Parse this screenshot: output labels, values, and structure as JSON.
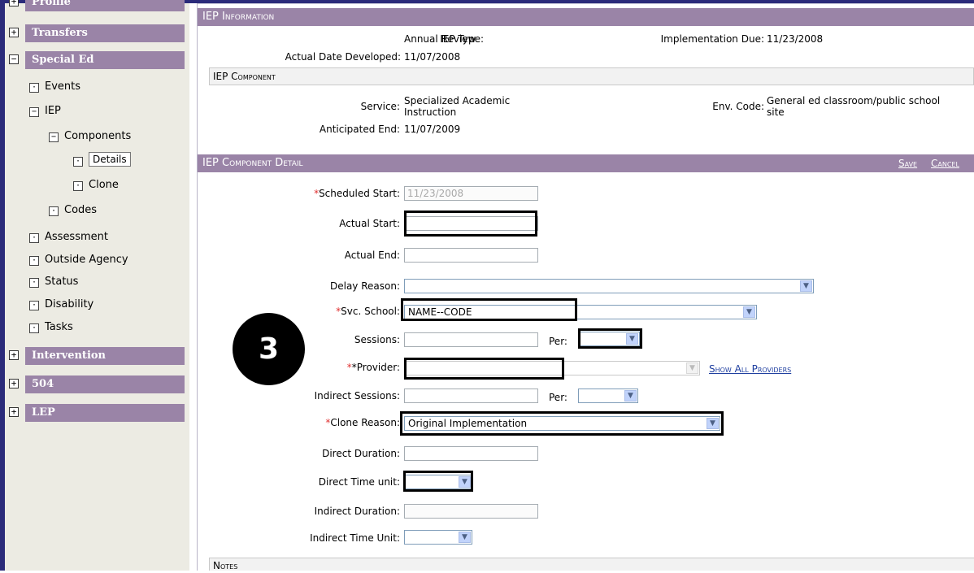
{
  "sidebar": {
    "sections": [
      {
        "label": "Profile",
        "toggle": "+"
      },
      {
        "label": "Transfers",
        "toggle": "+"
      },
      {
        "label": "Special Ed",
        "toggle": "−"
      },
      {
        "label": "Intervention",
        "toggle": "+"
      },
      {
        "label": "504",
        "toggle": "+"
      },
      {
        "label": "LEP",
        "toggle": "+"
      }
    ],
    "tree": [
      {
        "label": "Events",
        "toggle": "·"
      },
      {
        "label": "IEP",
        "toggle": "−"
      },
      {
        "label": "Components",
        "toggle": "−"
      },
      {
        "label": "Details",
        "toggle": "·"
      },
      {
        "label": "Clone",
        "toggle": "·"
      },
      {
        "label": "Codes",
        "toggle": "·"
      },
      {
        "label": "Assessment",
        "toggle": "·"
      },
      {
        "label": "Outside Agency",
        "toggle": "·"
      },
      {
        "label": "Status",
        "toggle": "·"
      },
      {
        "label": "Disability",
        "toggle": "·"
      },
      {
        "label": "Tasks",
        "toggle": "·"
      }
    ]
  },
  "iep_info": {
    "header": "IEP Information",
    "iep_type_label": "IEP Type:",
    "iep_type": "Annual Review",
    "impl_due_label": "Implementation Due:",
    "impl_due": "11/23/2008",
    "date_dev_label": "Actual Date Developed:",
    "date_dev": "11/07/2008"
  },
  "iep_component": {
    "header": "IEP Component",
    "service_label": "Service:",
    "service_line1": "Specialized Academic",
    "service_line2": "Instruction",
    "env_label": "Env. Code:",
    "env_line1": "General ed classroom/public school",
    "env_line2": "site",
    "ant_end_label": "Anticipated End:",
    "ant_end": "11/07/2009"
  },
  "detail": {
    "header": "IEP Component Detail",
    "save": "Save",
    "cancel": "Cancel",
    "required_mark": "*",
    "scheduled_start_label": "Scheduled Start:",
    "scheduled_start": "11/23/2008",
    "actual_start_label": "Actual Start:",
    "actual_start": "",
    "actual_end_label": "Actual End:",
    "actual_end": "",
    "delay_reason_label": "Delay Reason:",
    "delay_reason": "",
    "svc_school_label": "Svc. School:",
    "svc_school": "NAME--CODE",
    "sessions_label": "Sessions:",
    "sessions": "",
    "per_label": "Per:",
    "per": "",
    "provider_label": "*Provider:",
    "provider": "",
    "show_all_providers": "Show All Providers",
    "indirect_sessions_label": "Indirect Sessions:",
    "indirect_sessions": "",
    "indirect_per": "",
    "clone_reason_label": "Clone Reason:",
    "clone_reason": "Original Implementation",
    "direct_duration_label": "Direct Duration:",
    "direct_duration": "",
    "direct_time_unit_label": "Direct Time unit:",
    "direct_time_unit": "",
    "indirect_duration_label": "Indirect Duration:",
    "indirect_duration": "",
    "indirect_time_unit_label": "Indirect Time Unit:",
    "indirect_time_unit": ""
  },
  "notes": {
    "header": "Notes"
  },
  "step_badge": "3",
  "colors": {
    "header_bg": "#9a84a7",
    "sidebar_bg": "#ecebe3",
    "frame": "#2b2b7a",
    "link": "#1f3fa0",
    "required": "#e03030"
  }
}
